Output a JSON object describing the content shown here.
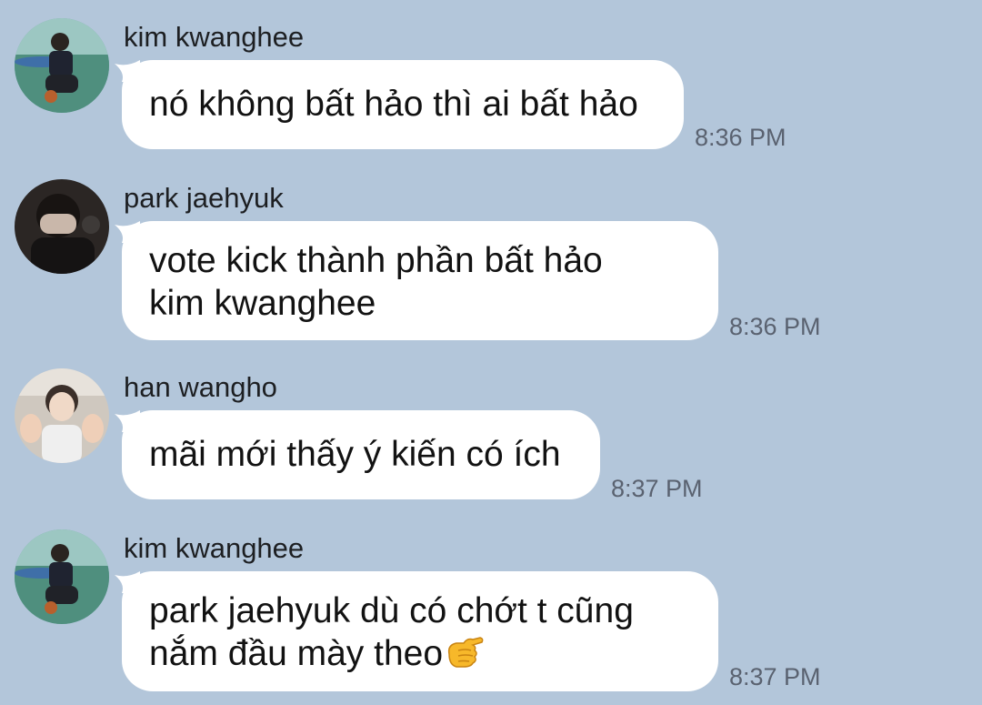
{
  "colors": {
    "background": "#b3c6da",
    "bubble": "#ffffff",
    "timestamp": "#5a6270"
  },
  "messages": [
    {
      "sender": "kim kwanghee",
      "lines": [
        "nó không bất hảo thì ai bất hảo"
      ],
      "time": "8:36 PM",
      "avatar": "avatar-kim-kwanghee"
    },
    {
      "sender": "park jaehyuk",
      "lines": [
        "vote kick thành phần bất hảo",
        "kim kwanghee"
      ],
      "time": "8:36 PM",
      "avatar": "avatar-park-jaehyuk"
    },
    {
      "sender": "han wangho",
      "lines": [
        "mãi mới thấy ý kiến có ích"
      ],
      "time": "8:37 PM",
      "avatar": "avatar-han-wangho"
    },
    {
      "sender": "kim kwanghee",
      "lines": [
        "park jaehyuk dù có chớt t cũng",
        "nắm đầu mày theo"
      ],
      "time": "8:37 PM",
      "avatar": "avatar-kim-kwanghee",
      "emoji": "pointing-hand-emoji"
    }
  ]
}
